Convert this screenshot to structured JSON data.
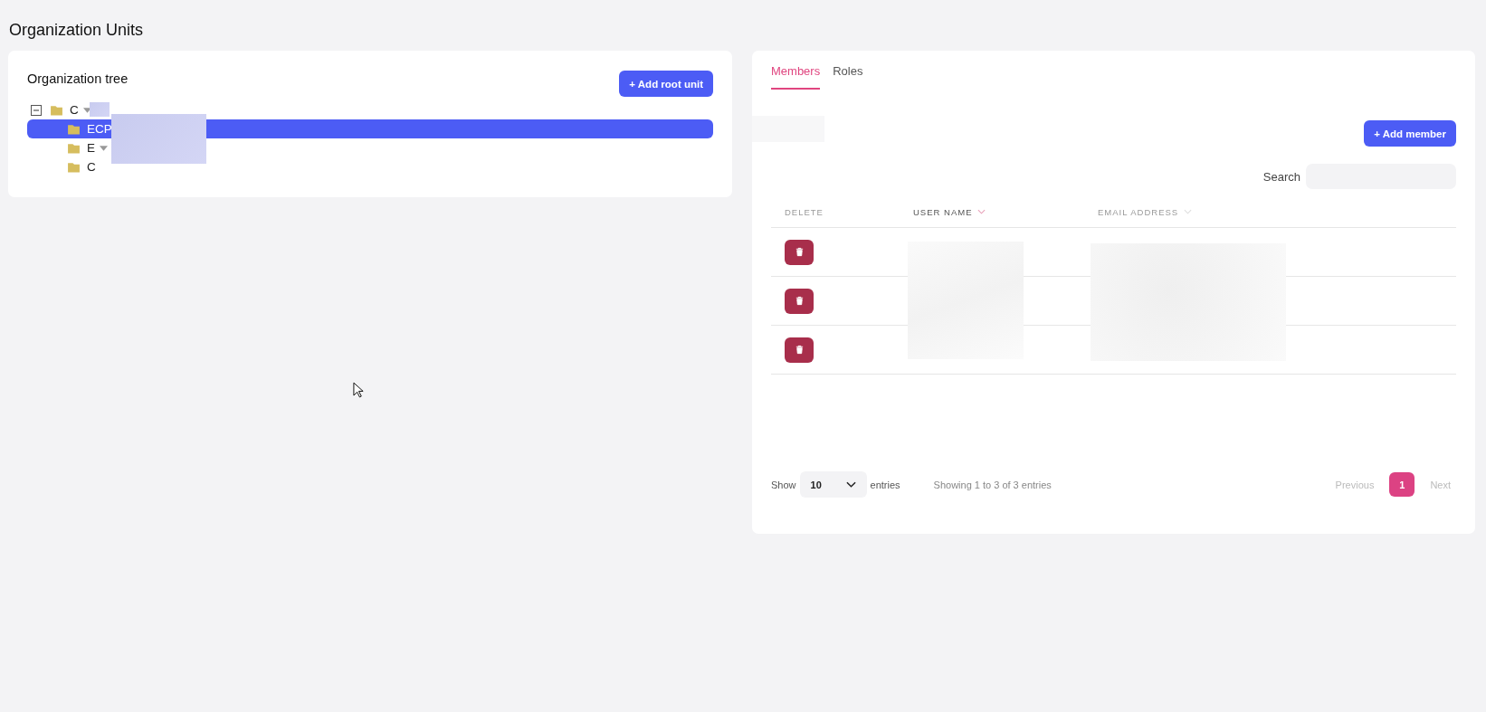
{
  "page_title": "Organization Units",
  "tree": {
    "title": "Organization tree",
    "add_button": "+ Add root unit",
    "items": [
      {
        "label": "C",
        "expanded": true,
        "selected": false,
        "has_menu": true,
        "children": [
          {
            "label": "ECP",
            "selected": true,
            "has_menu": false
          },
          {
            "label": "E",
            "selected": false,
            "has_menu": true
          },
          {
            "label": "C",
            "selected": false,
            "has_menu": false
          }
        ]
      }
    ]
  },
  "tabs": [
    {
      "label": "Members",
      "selected": true
    },
    {
      "label": "Roles",
      "selected": false
    }
  ],
  "add_member_button": "+ Add member",
  "search": {
    "label": "Search"
  },
  "table": {
    "columns": [
      {
        "label": "DELETE",
        "sortable": false,
        "sorted": false
      },
      {
        "label": "USER NAME",
        "sortable": true,
        "sorted": true
      },
      {
        "label": "EMAIL ADDRESS",
        "sortable": true,
        "sorted": false
      }
    ],
    "rows": [
      {
        "deletable": true
      },
      {
        "deletable": true
      },
      {
        "deletable": true
      }
    ]
  },
  "footer": {
    "show": "Show",
    "page_size": "10",
    "entries": "entries",
    "info": "Showing 1 to 3 of 3 entries",
    "previous": "Previous",
    "pages": [
      {
        "label": "1",
        "selected": true
      }
    ],
    "next": "Next"
  }
}
